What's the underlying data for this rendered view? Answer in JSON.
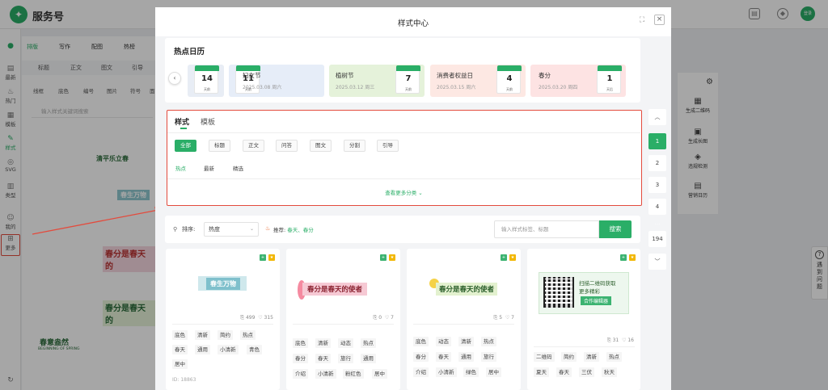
{
  "app": {
    "title": "服务号",
    "avatar_text": "登录"
  },
  "left_nav": [
    {
      "label": "最新",
      "icon": "document-icon"
    },
    {
      "label": "热门",
      "icon": "fire-icon"
    },
    {
      "label": "模板",
      "icon": "template-icon"
    },
    {
      "label": "样式",
      "icon": "style-icon"
    },
    {
      "label": "SVG",
      "icon": "svg-icon"
    },
    {
      "label": "类型",
      "icon": "grid-icon"
    },
    {
      "label": "我的",
      "icon": "user-icon"
    },
    {
      "label": "更多",
      "icon": "more-icon"
    }
  ],
  "bg_editor": {
    "tabs": [
      "排版",
      "写作",
      "配图",
      "热榜"
    ],
    "subtabs": [
      "标题",
      "正文",
      "图文",
      "引导"
    ],
    "subtabs2": [
      "线框",
      "底色",
      "编号",
      "图片",
      "符号",
      "面"
    ],
    "search_placeholder": "输入样式关键词搜索",
    "cards": [
      "清平乐立春",
      "春生万物",
      "春分是春天的",
      "春分是春天的",
      "春意盎然"
    ],
    "card_sub": "BEGINNING OF SPRING"
  },
  "right_tools": [
    {
      "label": "生成二维码",
      "icon": "qrcode-icon"
    },
    {
      "label": "生成长图",
      "icon": "long-image-icon"
    },
    {
      "label": "违规检测",
      "icon": "shield-icon"
    },
    {
      "label": "营销日历",
      "icon": "calendar-icon"
    }
  ],
  "help": {
    "label": "遇到问题"
  },
  "modal": {
    "title": "样式中心",
    "calendar": {
      "title": "热点日历",
      "items": [
        {
          "num": "14",
          "cap": "天前",
          "name": "",
          "date": ""
        },
        {
          "num": "11",
          "cap": "天前",
          "name": "妇女节",
          "date": "2025.03.08  周六"
        },
        {
          "num": "7",
          "cap": "天前",
          "name": "植树节",
          "date": "2025.03.12  周三"
        },
        {
          "num": "4",
          "cap": "天前",
          "name": "消费者权益日",
          "date": "2025.03.15  周六"
        },
        {
          "num": "1",
          "cap": "天后",
          "name": "春分",
          "date": "2025.03.20  周四"
        }
      ]
    },
    "filter": {
      "tabs": [
        "样式",
        "模板"
      ],
      "chips": [
        "全部",
        "标题",
        "正文",
        "问答",
        "图文",
        "分割",
        "引导"
      ],
      "sub": [
        "热点",
        "最新",
        "精选"
      ],
      "more": "查看更多分类 ⌄"
    },
    "sortbar": {
      "label": "排序:",
      "select": "热度",
      "rec_label": "推荐:",
      "rec_tags": "春天、春分",
      "search_placeholder": "输入样式标签、标题",
      "search_btn": "搜索"
    },
    "cards": [
      {
        "banner": "春生万物",
        "likes_a": "499",
        "likes_b": "315",
        "tags": [
          "底色",
          "清新",
          "简约",
          "热点",
          "春天",
          "通用",
          "小清新",
          "青色",
          "居中"
        ],
        "id": "ID: 18863"
      },
      {
        "banner": "春分是春天的使者",
        "likes_a": "0",
        "likes_b": "7",
        "tags": [
          "底色",
          "清新",
          "动态",
          "热点",
          "春分",
          "春天",
          "旅行",
          "通用",
          "介绍",
          "小清新",
          "粉红色",
          "居中"
        ],
        "id": ""
      },
      {
        "banner": "春分是春天的使者",
        "likes_a": "5",
        "likes_b": "7",
        "tags": [
          "底色",
          "动态",
          "清新",
          "热点",
          "春分",
          "春天",
          "通用",
          "旅行",
          "介绍",
          "小清新",
          "绿色",
          "居中"
        ],
        "id": ""
      },
      {
        "banner_line1": "扫描二维码获取",
        "banner_line2": "更多精彩",
        "banner_btn": "合作编辑器",
        "likes_a": "31",
        "likes_b": "16",
        "tags": [
          "二维码",
          "简约",
          "清新",
          "热点",
          "夏天",
          "春天",
          "三伏",
          "秋天"
        ],
        "id": ""
      }
    ],
    "pager": [
      "1",
      "2",
      "3",
      "4",
      "...",
      "194"
    ]
  },
  "colors": {
    "accent": "#2aae67",
    "highlight": "#e34b3d"
  }
}
